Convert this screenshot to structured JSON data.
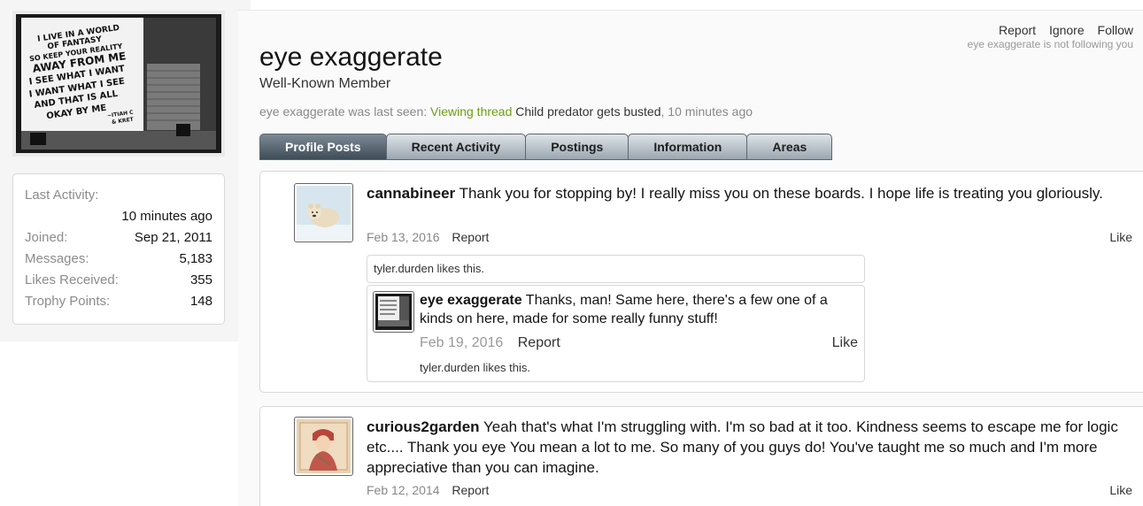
{
  "sidebar": {
    "stats": {
      "last_activity_label": "Last Activity:",
      "last_activity_value": "10 minutes ago",
      "joined_label": "Joined:",
      "joined_value": "Sep 21, 2011",
      "messages_label": "Messages:",
      "messages_value": "5,183",
      "likes_label": "Likes Received:",
      "likes_value": "355",
      "trophy_label": "Trophy Points:",
      "trophy_value": "148"
    },
    "avatar_lines": [
      "I LIVE IN A WORLD",
      "OF FANTASY",
      "SO KEEP YOUR REALITY",
      "AWAY FROM ME",
      "I SEE WHAT I WANT",
      "I WANT WHAT I SEE",
      "AND THAT IS ALL",
      "OKAY BY ME",
      "~ITIAH C",
      "& KRET"
    ]
  },
  "header": {
    "report": "Report",
    "ignore": "Ignore",
    "follow": "Follow",
    "not_following": "eye exaggerate is not following you",
    "username": "eye exaggerate",
    "user_title": "Well-Known Member",
    "last_seen_prefix": "eye exaggerate was last seen:",
    "last_seen_action": "Viewing thread",
    "last_seen_thread": "Child predator gets busted",
    "last_seen_time": ", 10 minutes ago"
  },
  "tabs": [
    {
      "label": "Profile Posts",
      "active": true
    },
    {
      "label": "Recent Activity",
      "active": false
    },
    {
      "label": "Postings",
      "active": false
    },
    {
      "label": "Information",
      "active": false
    },
    {
      "label": "Areas",
      "active": false
    }
  ],
  "posts": [
    {
      "author": "cannabineer",
      "text": "Thank you for stopping by! I really miss you on these boards. I hope life is treating you gloriously.",
      "date": "Feb 13, 2016",
      "report": "Report",
      "like": "Like",
      "likes_summary": "tyler.durden likes this.",
      "comment": {
        "author": "eye exaggerate",
        "text": "Thanks, man! Same here, there's a few one of a kinds on here, made for some really funny stuff!",
        "date": "Feb 19, 2016",
        "report": "Report",
        "like": "Like",
        "likes_summary": "tyler.durden likes this."
      }
    },
    {
      "author": "curious2garden",
      "text": "Yeah that's what I'm struggling with. I'm so bad at it too. Kindness seems to escape me for logic etc.... Thank you eye You mean a lot to me. So many of you guys do! You've taught me so much and I'm more appreciative than you can imagine.",
      "date": "Feb 12, 2014",
      "report": "Report",
      "like": "Like"
    }
  ]
}
